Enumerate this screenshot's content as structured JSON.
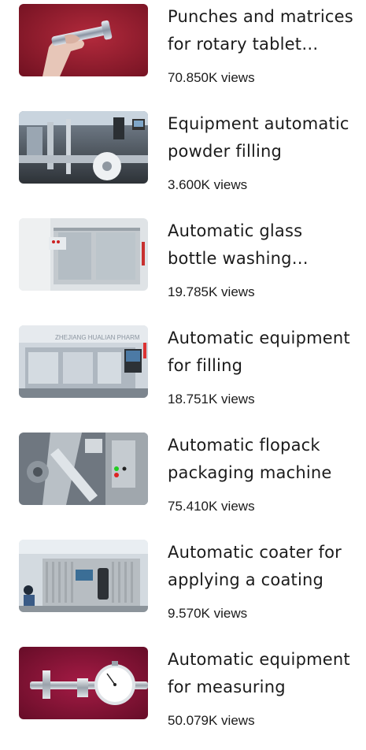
{
  "videos": [
    {
      "title": "Punches and matrices for rotary tablet presses",
      "views": "70.850K views",
      "thumb_theme": "red-hand-punch",
      "accent": "#9b1b2f"
    },
    {
      "title": "Equipment automatic powder filling",
      "views": "3.600K views",
      "thumb_theme": "factory-line",
      "accent": "#5c6a78"
    },
    {
      "title": "Automatic glass bottle washing machine",
      "views": "19.785K views",
      "thumb_theme": "glass-cabinet",
      "accent": "#b7c0c8"
    },
    {
      "title": "Automatic equipment for filling",
      "views": "18.751K views",
      "thumb_theme": "hualian-machine",
      "accent": "#8f9aa6"
    },
    {
      "title": "Automatic flopack packaging machine",
      "views": "75.410K views",
      "thumb_theme": "flopack-machine",
      "accent": "#7d858c"
    },
    {
      "title": "Automatic coater for applying a coating",
      "views": "9.570K views",
      "thumb_theme": "coater-machine",
      "accent": "#a9aeb3"
    },
    {
      "title": "Automatic equipment for measuring",
      "views": "50.079K views",
      "thumb_theme": "red-dial-gauge",
      "accent": "#8e1436"
    }
  ],
  "thumb_watermark": "ZHEJIANG HUALIAN PHARM"
}
